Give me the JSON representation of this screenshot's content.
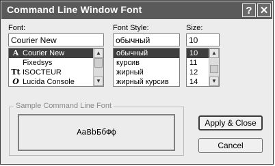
{
  "window": {
    "title": "Command Line Window Font",
    "help_symbol": "?",
    "close_symbol": "✕"
  },
  "font": {
    "label": "Font:",
    "value": "Courier New",
    "items": [
      {
        "name": "Courier New",
        "icon": "raster-font-icon",
        "glyph": "A"
      },
      {
        "name": "Fixedsys",
        "icon": "",
        "glyph": ""
      },
      {
        "name": "ISOCTEUR",
        "icon": "truetype-font-icon",
        "glyph": "Tt"
      },
      {
        "name": "Lucida Console",
        "icon": "opentype-font-icon",
        "glyph": "O"
      }
    ]
  },
  "style": {
    "label": "Font Style:",
    "value": "обычный",
    "items": [
      "обычный",
      "курсив",
      "жирный",
      "жирный курсив"
    ]
  },
  "size": {
    "label": "Size:",
    "value": "10",
    "items": [
      "10",
      "11",
      "12",
      "14"
    ]
  },
  "sample": {
    "group_label": "Sample Command Line Font",
    "text": "AaBbБбФф"
  },
  "buttons": {
    "apply": "Apply & Close",
    "cancel": "Cancel"
  },
  "icons": {
    "scroll_up": "▲",
    "scroll_down": "▼"
  }
}
